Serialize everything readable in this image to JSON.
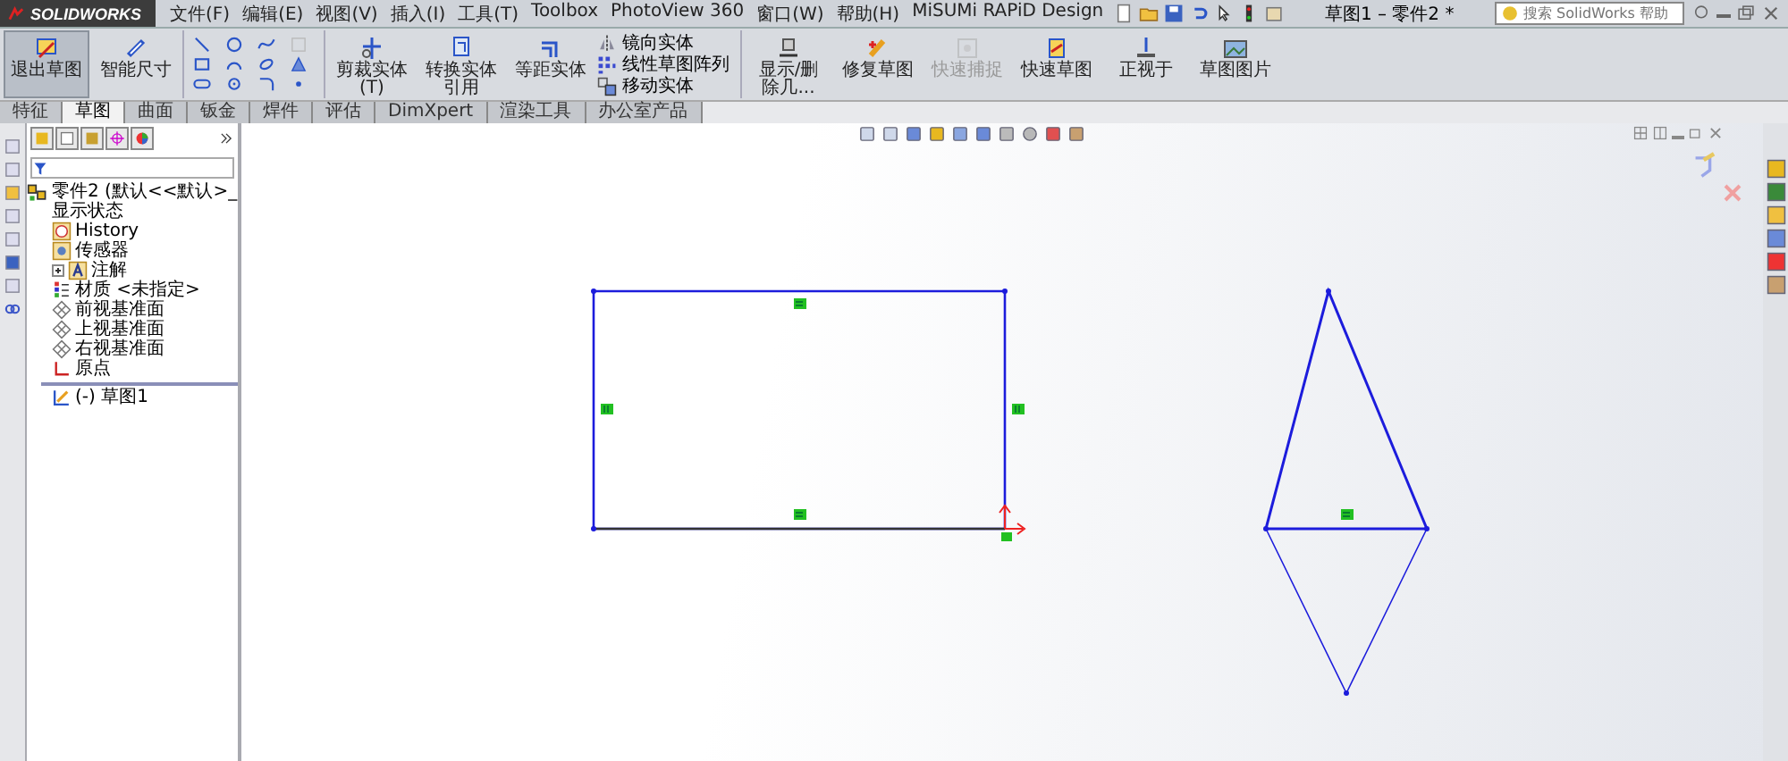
{
  "app": {
    "logo": "SOLIDWORKS"
  },
  "menu": [
    "文件(F)",
    "编辑(E)",
    "视图(V)",
    "插入(I)",
    "工具(T)",
    "Toolbox",
    "PhotoView 360",
    "窗口(W)",
    "帮助(H)",
    "MiSUMi RAPiD Design"
  ],
  "title": "草图1 – 零件2 *",
  "search": {
    "placeholder": "搜索 SolidWorks 帮助"
  },
  "ribbon": [
    {
      "kind": "big",
      "label": "退出草图",
      "selected": true,
      "disabled": false
    },
    {
      "kind": "big",
      "label": "智能尺寸",
      "selected": false,
      "disabled": false
    },
    {
      "kind": "tools"
    },
    {
      "kind": "big",
      "label": "剪裁实体(T)",
      "selected": false,
      "disabled": false
    },
    {
      "kind": "big",
      "label": "转换实体引用",
      "selected": false,
      "disabled": false
    },
    {
      "kind": "big",
      "label": "等距实体",
      "selected": false,
      "disabled": false
    },
    {
      "kind": "list",
      "items": [
        "镜向实体",
        "线性草图阵列",
        "移动实体"
      ]
    },
    {
      "kind": "big",
      "label": "显示/删除几...",
      "selected": false,
      "disabled": false
    },
    {
      "kind": "big",
      "label": "修复草图",
      "selected": false,
      "disabled": false
    },
    {
      "kind": "big",
      "label": "快速捕捉",
      "selected": false,
      "disabled": true
    },
    {
      "kind": "big",
      "label": "快速草图",
      "selected": false,
      "disabled": false
    },
    {
      "kind": "big",
      "label": "正视于",
      "selected": false,
      "disabled": false
    },
    {
      "kind": "big",
      "label": "草图图片",
      "selected": false,
      "disabled": false
    }
  ],
  "tabs": [
    {
      "label": "特征",
      "selected": false
    },
    {
      "label": "草图",
      "selected": true
    },
    {
      "label": "曲面",
      "selected": false
    },
    {
      "label": "钣金",
      "selected": false
    },
    {
      "label": "焊件",
      "selected": false
    },
    {
      "label": "评估",
      "selected": false
    },
    {
      "label": "DimXpert",
      "selected": false
    },
    {
      "label": "渲染工具",
      "selected": false
    },
    {
      "label": "办公室产品",
      "selected": false
    }
  ],
  "tree": {
    "root": {
      "kind": "part",
      "label": "零件2 (默认<<默认>_显示状态",
      "children": [
        {
          "kind": "history",
          "label": "History"
        },
        {
          "kind": "sensor",
          "label": "传感器"
        },
        {
          "kind": "annotation",
          "label": "注解",
          "expanded": false
        },
        {
          "kind": "material",
          "label": "材质 <未指定>"
        },
        {
          "kind": "plane",
          "label": "前视基准面"
        },
        {
          "kind": "plane",
          "label": "上视基准面"
        },
        {
          "kind": "plane",
          "label": "右视基准面"
        },
        {
          "kind": "origin",
          "label": "原点"
        },
        {
          "kind": "sketch",
          "label": "(-) 草图1"
        }
      ]
    }
  }
}
